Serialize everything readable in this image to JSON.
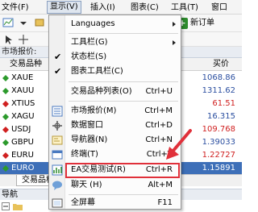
{
  "menubar": {
    "items": [
      {
        "label": "文件(F)"
      },
      {
        "label": "显示(V)"
      },
      {
        "label": "插入(I)"
      },
      {
        "label": "图表(C)"
      },
      {
        "label": "工具(T)"
      },
      {
        "label": "窗口"
      }
    ]
  },
  "toolbar": {
    "new_order_label": "新订单"
  },
  "market_watch": {
    "title": "市场报价:",
    "col_symbol": "交易品种",
    "col_ask": "买价",
    "rows": [
      {
        "symbol": "XAUE",
        "ask": "1068.86",
        "color": "#2b4fa0",
        "dir": "up"
      },
      {
        "symbol": "XAUU",
        "ask": "1311.62",
        "color": "#2b4fa0",
        "dir": "up"
      },
      {
        "symbol": "XTIUS",
        "ask": "61.51",
        "color": "#d02020",
        "dir": "down"
      },
      {
        "symbol": "XAGU",
        "ask": "16.315",
        "color": "#2b4fa0",
        "dir": "up"
      },
      {
        "symbol": "USDJ",
        "ask": "109.768",
        "color": "#d02020",
        "dir": "down"
      },
      {
        "symbol": "GBPU",
        "ask": "1.39033",
        "color": "#2b4fa0",
        "dir": "up"
      },
      {
        "symbol": "EURU",
        "ask": "1.22727",
        "color": "#d02020",
        "dir": "down"
      },
      {
        "symbol": "EURO",
        "ask": "1.15891",
        "color": "#ffffff",
        "dir": "up"
      }
    ],
    "tab_label": "交易品种"
  },
  "navigator": {
    "title": "导航",
    "row_label": ""
  },
  "view_menu": {
    "items": [
      {
        "label": "Languages",
        "shortcut": "",
        "submenu": true
      },
      {
        "label": "工具栏(G)",
        "shortcut": "",
        "submenu": true
      },
      {
        "label": "状态栏(S)",
        "shortcut": "",
        "checked": true
      },
      {
        "label": "图表工具栏(C)",
        "shortcut": "",
        "checked": true
      },
      {
        "label": "交易品种列表(O)",
        "shortcut": "Ctrl+U"
      },
      {
        "label": "市场报价(M)",
        "shortcut": "Ctrl+M"
      },
      {
        "label": "数据窗口",
        "shortcut": "Ctrl+D"
      },
      {
        "label": "导航器(N)",
        "shortcut": "Ctrl+N"
      },
      {
        "label": "终端(T)",
        "shortcut": "Ctrl+T"
      },
      {
        "label": "EA交易测试(R)",
        "shortcut": "Ctrl+R"
      },
      {
        "label": "聊天 (H)",
        "shortcut": "Alt+M"
      },
      {
        "label": "全屏幕",
        "shortcut": "F11"
      }
    ]
  },
  "colors": {
    "highlight_border": "#e0303a",
    "selected_row": "#3d6fb8"
  }
}
